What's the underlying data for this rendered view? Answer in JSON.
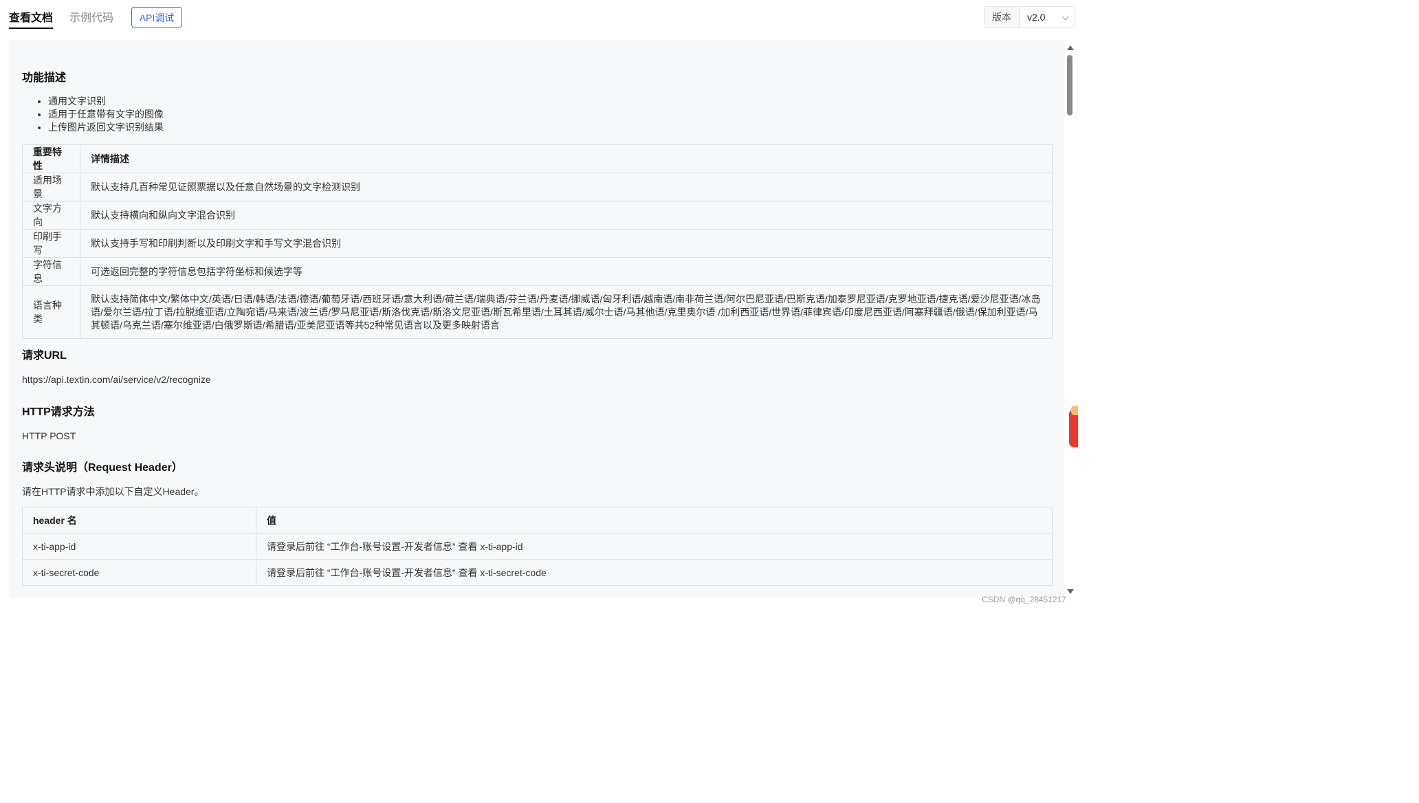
{
  "tabs": {
    "docs": "查看文档",
    "sample": "示例代码",
    "api": "API调试"
  },
  "version": {
    "label": "版本",
    "value": "v2.0"
  },
  "features": {
    "title": "功能描述",
    "bullets": [
      "通用文字识别",
      "适用于任意带有文字的图像",
      "上传图片返回文字识别结果"
    ],
    "table": {
      "headers": [
        "重要特性",
        "详情描述"
      ],
      "rows": [
        [
          "适用场景",
          "默认支持几百种常见证照票据以及任意自然场景的文字检测识别"
        ],
        [
          "文字方向",
          "默认支持横向和纵向文字混合识别"
        ],
        [
          "印刷手写",
          "默认支持手写和印刷判断以及印刷文字和手写文字混合识别"
        ],
        [
          "字符信息",
          "可选返回完整的字符信息包括字符坐标和候选字等"
        ],
        [
          "语言种类",
          "默认支持简体中文/繁体中文/英语/日语/韩语/法语/德语/葡萄牙语/西班牙语/意大利语/荷兰语/瑞典语/芬兰语/丹麦语/挪威语/匈牙利语/越南语/南非荷兰语/阿尔巴尼亚语/巴斯克语/加泰罗尼亚语/克罗地亚语/捷克语/爱沙尼亚语/冰岛语/爱尔兰语/拉丁语/拉脱维亚语/立陶宛语/马来语/波兰语/罗马尼亚语/斯洛伐克语/斯洛文尼亚语/斯瓦希里语/土耳其语/威尔士语/马其他语/克里奥尔语 /加利西亚语/世界语/菲律宾语/印度尼西亚语/阿塞拜疆语/俄语/保加利亚语/马其顿语/乌克兰语/塞尔维亚语/白俄罗斯语/希腊语/亚美尼亚语等共52种常见语言以及更多映射语言"
        ]
      ]
    }
  },
  "request_url": {
    "title": "请求URL",
    "value": "https://api.textin.com/ai/service/v2/recognize"
  },
  "http_method": {
    "title": "HTTP请求方法",
    "value": "HTTP POST"
  },
  "request_header": {
    "title": "请求头说明（Request Header）",
    "intro": "请在HTTP请求中添加以下自定义Header。",
    "table": {
      "headers": [
        "header 名",
        "值"
      ],
      "rows": [
        [
          "x-ti-app-id",
          "请登录后前往 “工作台-账号设置-开发者信息” 查看 x-ti-app-id"
        ],
        [
          "x-ti-secret-code",
          "请登录后前往 “工作台-账号设置-开发者信息” 查看 x-ti-secret-code"
        ]
      ]
    }
  },
  "watermark": "CSDN @qq_28451217",
  "colors": {
    "accent": "#2f6bff",
    "content_bg": "#f7f8fa",
    "border": "#dcdfe6"
  }
}
